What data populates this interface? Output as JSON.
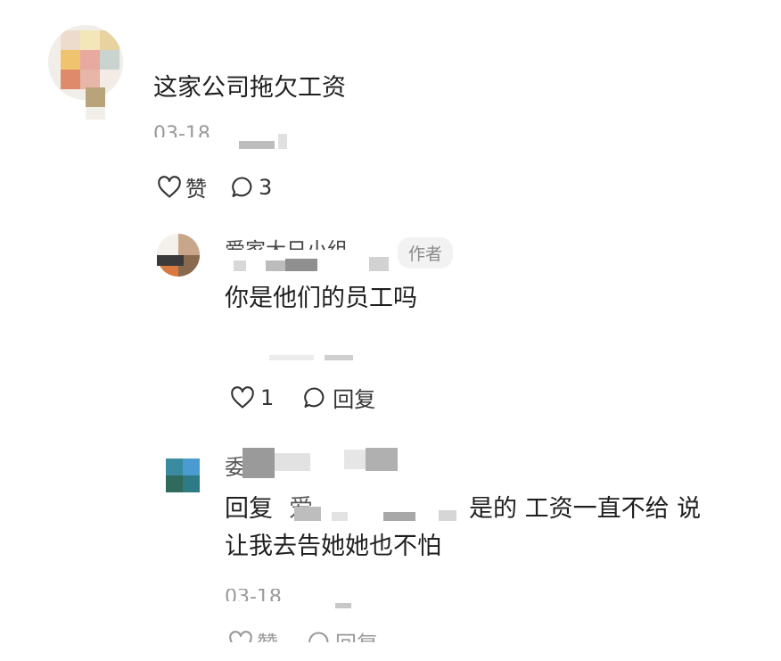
{
  "comment": {
    "text": "这家公司拖欠工资",
    "date": "03-18",
    "like_label": "赞",
    "reply_count": "3"
  },
  "reply1": {
    "author_name": "爱家大日小组",
    "author_badge": "作者",
    "text": "你是他们的员工吗",
    "like_count": "1",
    "reply_label": "回复"
  },
  "reply2": {
    "author_name": "委",
    "reply_prefix": "回复",
    "reply_to_initial": "爱",
    "text_line1": "是的 工资一直不给 说",
    "text_line2": "让我去告她她也不怕",
    "date": "03-18",
    "like_label": "赞",
    "reply_label": "回复"
  },
  "colors": {
    "text": "#1f1f1f",
    "meta": "#9a9a9a",
    "badge_bg": "#f2f2f2"
  }
}
